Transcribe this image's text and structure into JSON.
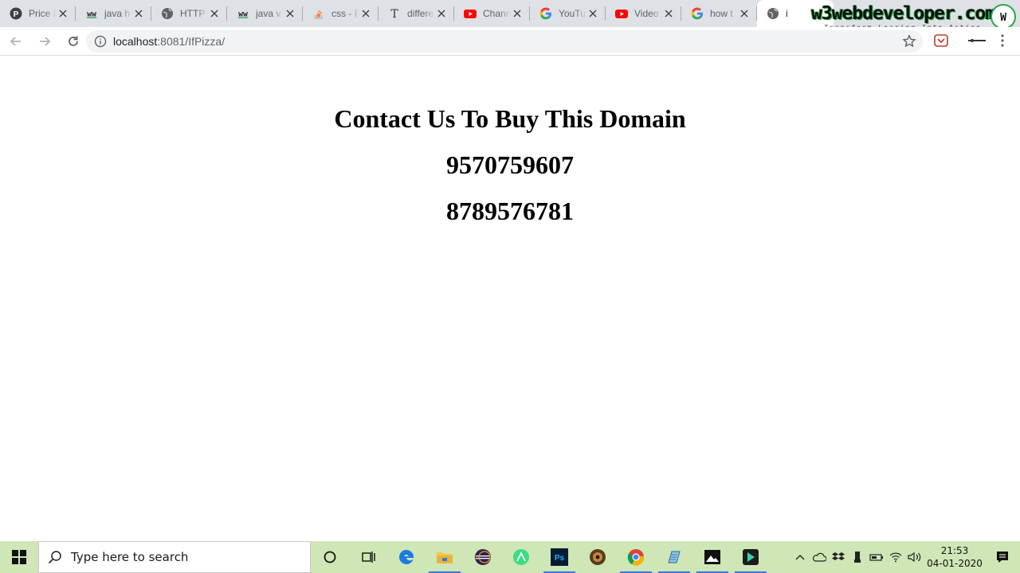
{
  "browser": {
    "tabs": [
      {
        "title": "Price I",
        "icon": "price-site-icon"
      },
      {
        "title": "java h",
        "icon": "w3-icon"
      },
      {
        "title": "HTTP",
        "icon": "globe-icon"
      },
      {
        "title": "java v",
        "icon": "w3-icon"
      },
      {
        "title": "css - F",
        "icon": "stackoverflow-icon"
      },
      {
        "title": "differe",
        "icon": "text-t-icon"
      },
      {
        "title": "Chann",
        "icon": "youtube-icon"
      },
      {
        "title": "YouTu",
        "icon": "google-icon"
      },
      {
        "title": "Video",
        "icon": "youtube-icon"
      },
      {
        "title": "how t",
        "icon": "google-icon"
      },
      {
        "title": "i",
        "icon": "globe-icon"
      }
    ],
    "url_host": "localhost",
    "url_rest": ":8081/IfPizza/"
  },
  "watermark": {
    "brand": "w3webdeveloper.com",
    "tagline": "Transform Learing Into Action"
  },
  "page": {
    "heading": "Contact Us To Buy This Domain",
    "phone1": "9570759607",
    "phone2": "8789576781"
  },
  "taskbar": {
    "search_placeholder": "Type here to search",
    "time": "21:53",
    "date": "04-01-2020"
  },
  "colors": {
    "taskbar_bg": "#cfe6b6",
    "tabstrip_bg": "#dee1e6",
    "watermark_green": "#2aa84a"
  }
}
